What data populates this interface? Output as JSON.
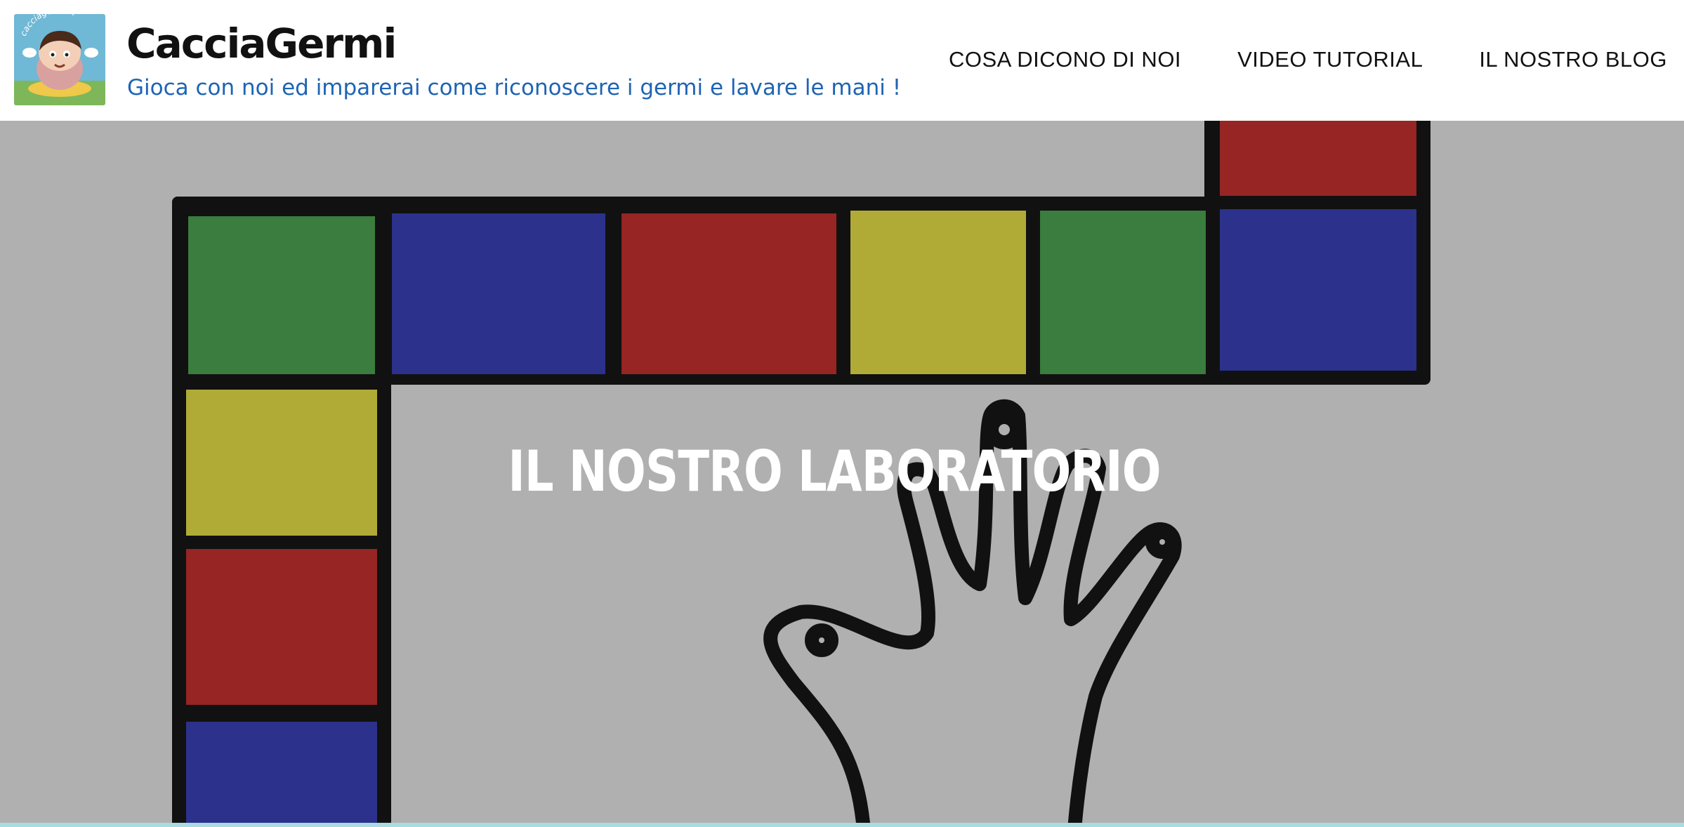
{
  "header": {
    "logo_alt": "cacciagermi.it",
    "title": "CacciaGermi",
    "tagline": "Gioca con noi ed imparerai come riconoscere i germi e lavare le mani !"
  },
  "nav": {
    "items": [
      {
        "label": "COSA DICONO DI NOI"
      },
      {
        "label": "VIDEO TUTORIAL"
      },
      {
        "label": "IL NOSTRO BLOG"
      }
    ]
  },
  "hero": {
    "title": "IL NOSTRO LABORATORIO"
  },
  "colors": {
    "tagline": "#1e64b4",
    "hero_bg": "#b0b0b0",
    "green": "#3a7d3e",
    "blue": "#2c318b",
    "red": "#962524",
    "yellow": "#b0ab37",
    "strip": "#a9dbe2"
  }
}
